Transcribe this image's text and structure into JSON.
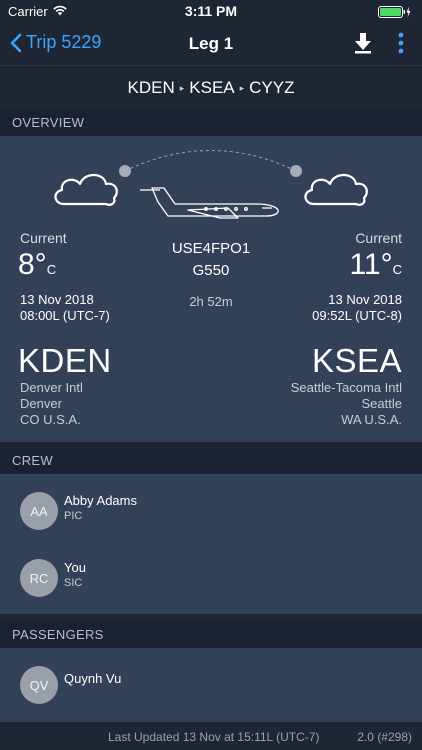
{
  "status_bar": {
    "carrier": "Carrier",
    "time": "3:11 PM"
  },
  "nav": {
    "back_label": "Trip 5229",
    "title": "Leg 1"
  },
  "route": {
    "stops": [
      "KDEN",
      "KSEA",
      "CYYZ"
    ]
  },
  "sections": {
    "overview": "OVERVIEW",
    "crew": "CREW",
    "passengers": "PASSENGERS"
  },
  "overview": {
    "departure": {
      "current_label": "Current",
      "temp_value": "8°",
      "temp_unit": "C",
      "date": "13 Nov 2018",
      "time": "08:00L (UTC-7)",
      "code": "KDEN",
      "name": "Denver Intl",
      "city": "Denver",
      "region": "CO U.S.A."
    },
    "arrival": {
      "current_label": "Current",
      "temp_value": "11°",
      "temp_unit": "C",
      "date": "13 Nov 2018",
      "time": "09:52L (UTC-8)",
      "code": "KSEA",
      "name": "Seattle-Tacoma Intl",
      "city": "Seattle",
      "region": "WA U.S.A."
    },
    "aircraft": {
      "registration": "USE4FPO1",
      "type": "G550",
      "duration": "2h 52m"
    }
  },
  "crew": [
    {
      "initials": "AA",
      "name": "Abby Adams",
      "role": "PIC"
    },
    {
      "initials": "RC",
      "name": "You",
      "role": "SIC"
    }
  ],
  "passengers": [
    {
      "initials": "QV",
      "name": "Quynh Vu"
    }
  ],
  "footer": {
    "updated": "Last Updated 13 Nov at 15:11L (UTC-7)",
    "version": "2.0 (#298)"
  },
  "colors": {
    "accent": "#3ea3ff",
    "background": "#1e2533",
    "panel": "#334158",
    "section_header": "#1a2130",
    "avatar": "#9aa0a8"
  },
  "icons": [
    "wifi-icon",
    "battery-icon",
    "chevron-left-icon",
    "download-icon",
    "more-vertical-icon",
    "cloud-icon",
    "plane-icon",
    "flight-path-icon"
  ]
}
